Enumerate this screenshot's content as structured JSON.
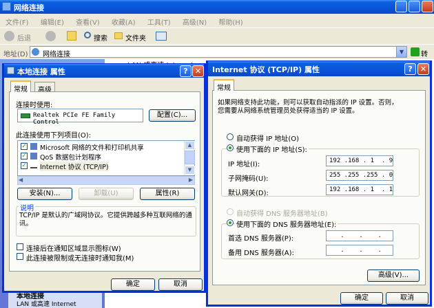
{
  "explorer": {
    "title": "网络连接",
    "menu": [
      "文件(F)",
      "编辑(E)",
      "查看(V)",
      "收藏(A)",
      "工具(T)",
      "高级(N)",
      "帮助(H)"
    ],
    "toolbar": {
      "back": "后退",
      "search": "搜索",
      "folders": "文件夹"
    },
    "address_label": "地址(D)",
    "address_value": "网络连接",
    "go_label": "转到",
    "bg_text": "LAN 或高速 Internet",
    "sidebar_title": "本地连接",
    "sidebar_text": "LAN 或高速 Internet"
  },
  "local": {
    "title": "本地连接 属性",
    "tabs": [
      "常规",
      "高级"
    ],
    "connect_using_label": "连接时使用:",
    "adapter_name": "Realtek PCIe FE Family Control",
    "configure_button": "配置(C)...",
    "items_label": "此连接使用下列项目(O):",
    "items": [
      {
        "label": "Microsoft 网络的文件和打印机共享",
        "checked": true
      },
      {
        "label": "QoS 数据包计划程序",
        "checked": true
      },
      {
        "label": "Internet 协议 (TCP/IP)",
        "checked": true
      }
    ],
    "install_button": "安装(N)...",
    "uninstall_button": "卸载(U)",
    "properties_button": "属性(R)",
    "desc_title": "说明",
    "desc_text": "TCP/IP 是默认的广域网协议。它提供跨越多种互联网络的通讯。",
    "show_icon_label": "连接后在通知区域显示图标(W)",
    "notify_label": "此连接被限制或无连接时通知我(M)",
    "ok_button": "确定",
    "cancel_button": "取消"
  },
  "tcpip": {
    "title": "Internet 协议 (TCP/IP) 属性",
    "tab": "常规",
    "intro_line1": "如果网络支持此功能，则可以获取自动指派的 IP 设置。否则，",
    "intro_line2": "您需要从网络系统管理员处获得适当的 IP 设置。",
    "auto_ip_label": "自动获得 IP 地址(O)",
    "manual_ip_label": "使用下面的 IP 地址(S):",
    "ip_label": "IP 地址(I):",
    "ip_value": "192 .168 . 1  . 9",
    "mask_label": "子网掩码(U):",
    "mask_value": "255 .255 .255 . 0",
    "gateway_label": "默认网关(D):",
    "gateway_value": "192 .168 . 1  . 1",
    "auto_dns_label": "自动获得 DNS 服务器地址(B)",
    "manual_dns_label": "使用下面的 DNS 服务器地址(E):",
    "dns1_label": "首选 DNS 服务器(P):",
    "dns1_value": "   .    .    .",
    "dns2_label": "备用 DNS 服务器(A):",
    "dns2_value": "   .    .    .",
    "advanced_button": "高级(V)...",
    "ok_button": "确定",
    "cancel_button": "取消"
  },
  "colors": {
    "title_blue": "#0a55d9",
    "dialog_bg": "#ece9d8",
    "radio_green": "#21a121"
  }
}
